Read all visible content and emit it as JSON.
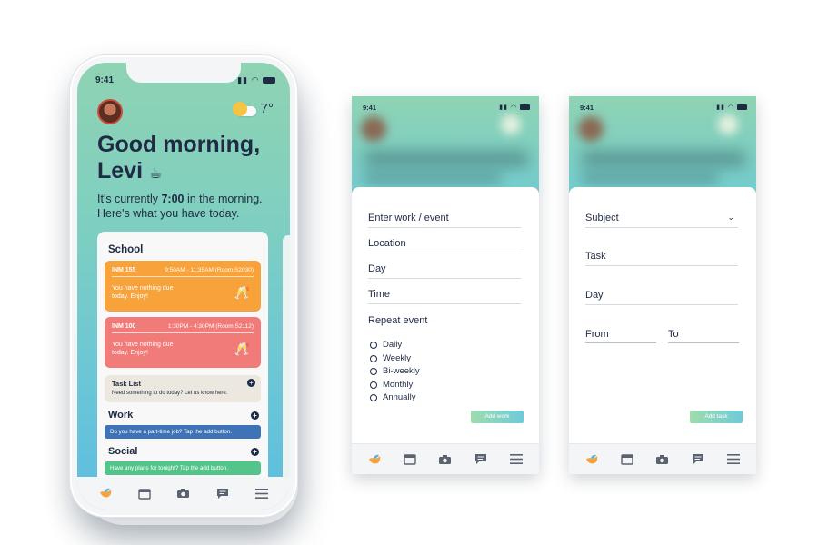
{
  "main_phone": {
    "status_time": "9:41",
    "temperature": "7°",
    "greeting_line1": "Good morning,",
    "greeting_line2": "Levi",
    "cup_emoji": "☕",
    "sub_intro": "It's currently ",
    "sub_time": "7:00",
    "sub_rest": " in the morning. Here's what you have today.",
    "school_title": "School",
    "classes": [
      {
        "code": "INM 155",
        "time": "9:50AM - 11:35AM (Room S2030)",
        "note": "You have nothing due today. Enjoy!",
        "color": "#f7a23a"
      },
      {
        "code": "INM 100",
        "time": "1:30PM - 4:30PM (Room S2112)",
        "note": "You have nothing due today. Enjoy!",
        "color": "#f07b78"
      }
    ],
    "task_list": {
      "title": "Task List",
      "desc": "Need something to do today? Let us know here."
    },
    "work": {
      "title": "Work",
      "desc": "Do you have a part-time job? Tap the add button."
    },
    "social": {
      "title": "Social",
      "desc": "Have any plans for tonight? Tap the add button."
    }
  },
  "work_form": {
    "status_time": "9:41",
    "fields": [
      "Enter work / event",
      "Location",
      "Day",
      "Time",
      "Repeat event"
    ],
    "repeat_options": [
      "Daily",
      "Weekly",
      "Bi-weekly",
      "Monthly",
      "Annually"
    ],
    "add_button": "Add work"
  },
  "task_form": {
    "status_time": "9:41",
    "subject": "Subject",
    "task": "Task",
    "day": "Day",
    "from": "From",
    "to": "To",
    "add_button": "Add task"
  },
  "colors": {
    "teal": "#7fcfc0",
    "navy": "#1f2a44",
    "blue_bar": "#3e73b8",
    "green_bar": "#53c58a"
  }
}
